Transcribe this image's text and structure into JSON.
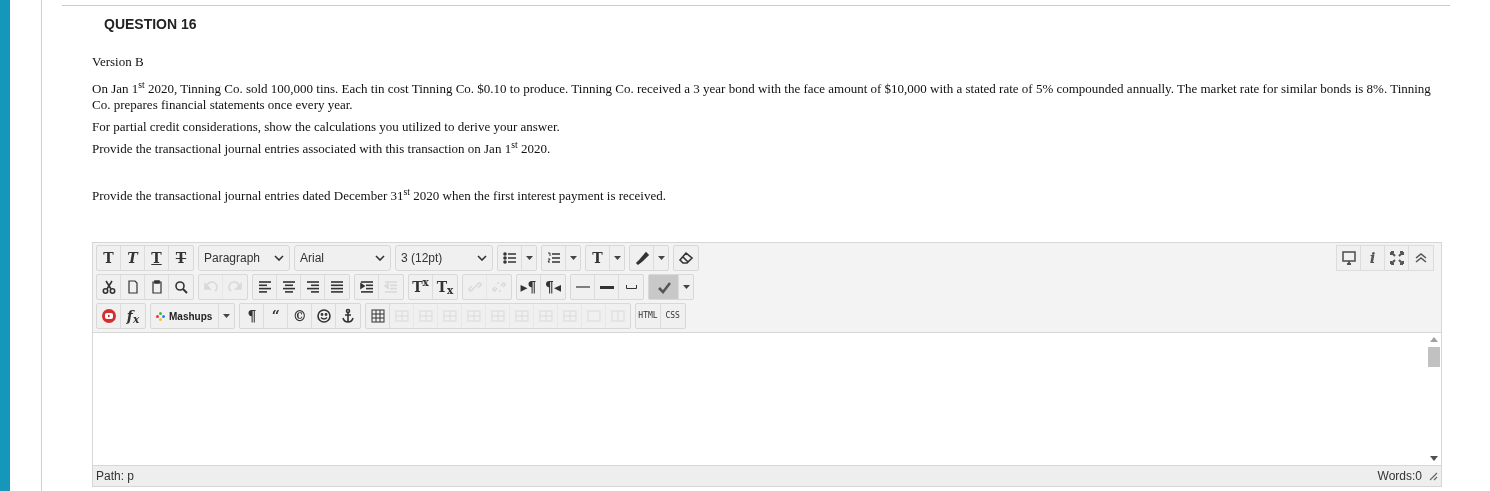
{
  "question": {
    "title": "QUESTION 16"
  },
  "paragraphs": [
    {
      "text": "Version B"
    },
    {
      "text": "On Jan 1$^{st}$ 2020, Tinning Co. sold 100,000 tins. Each tin cost Tinning Co. $0.10 to produce. Tinning Co. received a 3 year bond with the face amount of $10,000 with a stated rate of 5% compounded annually. The market rate for similar bonds is 8%. Tinning Co. prepares financial statements once every year."
    },
    {
      "text": "For partial credit considerations, show the calculations you utilized to derive your answer."
    },
    {
      "text": "Provide the transactional journal entries associated with this transaction on Jan 1$^{st}$ 2020."
    },
    {
      "text": "Provide the transactional journal entries dated December 31$^{st}$ 2020 when the first interest payment is received."
    }
  ],
  "editor": {
    "toolbar_rows": [
      [
        {
          "kind": "glyph",
          "label": "T",
          "disabled": false
        },
        {
          "kind": "glyph",
          "label": "T",
          "disabled": false
        },
        {
          "kind": "glyph",
          "label": "T",
          "disabled": false
        },
        {
          "kind": "glyph",
          "label": "T",
          "disabled": false
        },
        {
          "kind": "select",
          "label": "Paragraph"
        },
        {
          "kind": "select",
          "label": "Arial"
        },
        {
          "kind": "select",
          "label": "3 (12pt)"
        },
        {
          "kind": "icon-split",
          "disabled": false
        },
        {
          "kind": "icon-split",
          "disabled": false
        },
        {
          "kind": "glyph-split",
          "label": "T",
          "disabled": false
        },
        {
          "kind": "icon-split",
          "disabled": false
        },
        {
          "kind": "icon",
          "disabled": false
        }
      ],
      [
        {
          "kind": "icon",
          "disabled": false
        },
        {
          "kind": "icon",
          "disabled": false
        },
        {
          "kind": "icon",
          "disabled": false
        },
        {
          "kind": "icon",
          "disabled": false
        },
        {
          "kind": "icon",
          "disabled": true
        },
        {
          "kind": "icon",
          "disabled": true
        },
        {
          "kind": "icon",
          "disabled": false
        },
        {
          "kind": "icon",
          "disabled": false
        },
        {
          "kind": "icon",
          "disabled": false
        },
        {
          "kind": "icon",
          "disabled": false
        },
        {
          "kind": "icon",
          "disabled": false
        },
        {
          "kind": "icon",
          "disabled": true
        },
        {
          "kind": "glyph",
          "label": "T$^{x}$",
          "disabled": false
        },
        {
          "kind": "glyph",
          "label": "T$_{x}$",
          "disabled": false
        },
        {
          "kind": "icon",
          "disabled": true
        },
        {
          "kind": "icon",
          "disabled": true
        },
        {
          "kind": "glyph",
          "label": "▸¶",
          "disabled": false
        },
        {
          "kind": "glyph",
          "label": "¶◂",
          "disabled": false
        },
        {
          "kind": "icon",
          "disabled": false
        },
        {
          "kind": "icon",
          "disabled": false
        },
        {
          "kind": "icon",
          "disabled": false
        },
        {
          "kind": "icon-split",
          "disabled": false,
          "pressed": true
        }
      ],
      [
        {
          "kind": "icon",
          "disabled": false
        },
        {
          "kind": "glyph",
          "label": "f$_{x}$",
          "disabled": false
        },
        {
          "kind": "menu",
          "label": "Mashups"
        },
        {
          "kind": "glyph",
          "label": "¶",
          "disabled": false
        },
        {
          "kind": "glyph",
          "label": "“",
          "disabled": false
        },
        {
          "kind": "glyph",
          "label": "©",
          "disabled": false
        },
        {
          "kind": "icon",
          "disabled": false
        },
        {
          "kind": "icon",
          "disabled": false
        },
        {
          "kind": "icon",
          "disabled": false
        },
        {
          "kind": "icon",
          "disabled": true
        },
        {
          "kind": "icon",
          "disabled": true
        },
        {
          "kind": "icon",
          "disabled": true
        },
        {
          "kind": "icon",
          "disabled": true
        },
        {
          "kind": "icon",
          "disabled": true
        },
        {
          "kind": "icon",
          "disabled": true
        },
        {
          "kind": "icon",
          "disabled": true
        },
        {
          "kind": "icon",
          "disabled": true
        },
        {
          "kind": "icon",
          "disabled": true
        },
        {
          "kind": "icon",
          "disabled": true
        },
        {
          "kind": "text",
          "label": "HTML",
          "disabled": false
        },
        {
          "kind": "text",
          "label": "CSS",
          "disabled": false
        }
      ]
    ],
    "right_tools": [
      {
        "kind": "icon"
      },
      {
        "kind": "glyph",
        "label": "i"
      },
      {
        "kind": "icon"
      },
      {
        "kind": "icon"
      }
    ],
    "path": "Path: p",
    "words": "Words:0"
  }
}
